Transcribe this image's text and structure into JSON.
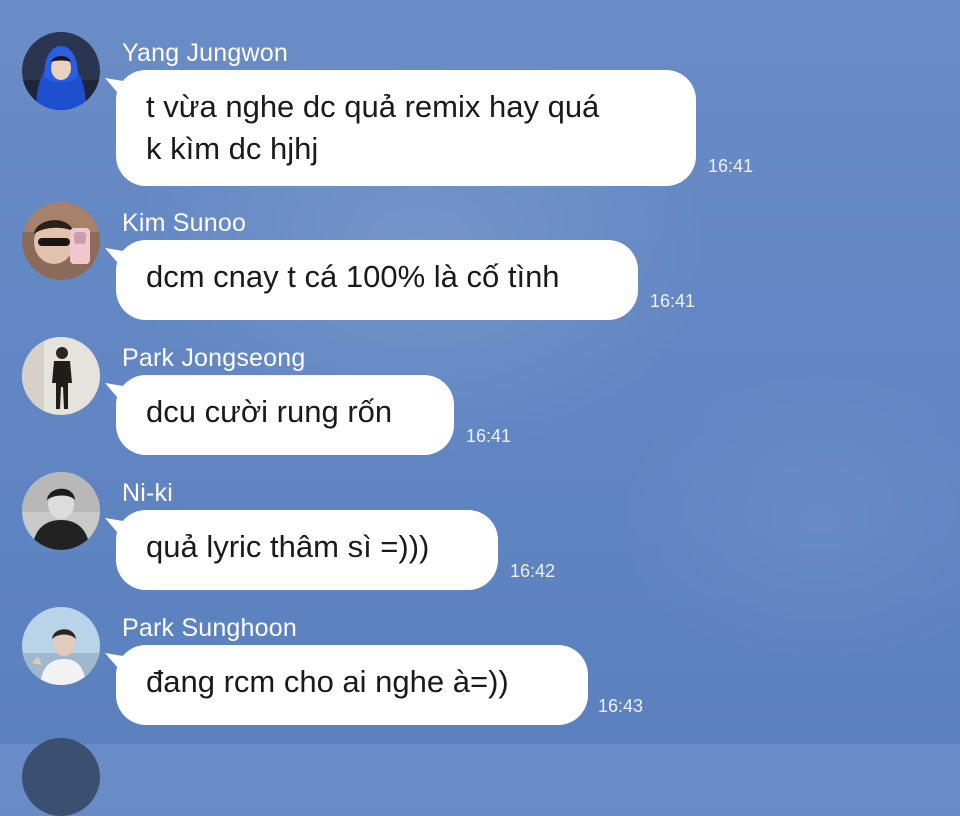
{
  "messages": [
    {
      "sender": "Yang Jungwon",
      "text": "t vừa nghe dc quả remix hay quá\nk kìm dc hjhj",
      "time": "16:41"
    },
    {
      "sender": "Kim Sunoo",
      "text": "dcm cnay t cá 100% là cố tình",
      "time": "16:41"
    },
    {
      "sender": "Park Jongseong",
      "text": "dcu cười rung rốn",
      "time": "16:41"
    },
    {
      "sender": "Ni-ki",
      "text": "quả lyric thâm sì =)))",
      "time": "16:42"
    },
    {
      "sender": "Park Sunghoon",
      "text": "đang rcm cho ai nghe à=))",
      "time": "16:43"
    }
  ],
  "colors": {
    "background": "#6488c4",
    "bubble": "#ffffff",
    "sender_text": "#ffffff",
    "timestamp_text": "#eef3fb"
  },
  "icons": [
    "avatar-blue-hoodie",
    "avatar-mirror-selfie",
    "avatar-full-body-dark",
    "avatar-portrait-dark",
    "avatar-outdoor-light"
  ]
}
